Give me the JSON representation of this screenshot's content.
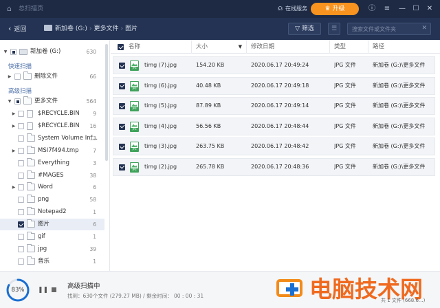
{
  "titlebar": {
    "app_title": "总扫描页",
    "service": "在线服务",
    "upgrade": "升级",
    "icons": [
      "home-icon",
      "headset-icon",
      "crown-icon",
      "info-icon",
      "menu-icon",
      "minimize-icon",
      "maximize-icon",
      "close-icon"
    ]
  },
  "nav": {
    "back": "返回",
    "crumbs": [
      "新加卷 (G:)",
      "更多文件",
      "图片"
    ],
    "filter": "筛选",
    "search_placeholder": "搜索文件或文件夹"
  },
  "sidebar": {
    "root": {
      "label": "新加卷 (G:)",
      "count": "630"
    },
    "quick_scan": "快速扫描",
    "deleted": {
      "label": "删除文件",
      "count": "66"
    },
    "advanced_scan": "高级扫描",
    "more_files": {
      "label": "更多文件",
      "count": "564"
    },
    "items": [
      {
        "label": "$RECYCLE.BIN",
        "count": "9",
        "expand": true,
        "type": "doc"
      },
      {
        "label": "$RECYCLE.BIN",
        "count": "16",
        "expand": true,
        "type": "doc"
      },
      {
        "label": "System Volume Inf...",
        "count": "13",
        "expand": false,
        "type": "folder"
      },
      {
        "label": "MSI7f494.tmp",
        "count": "7",
        "expand": true,
        "type": "folder"
      },
      {
        "label": "Everything",
        "count": "3",
        "expand": false,
        "type": "folder"
      },
      {
        "label": "#MAGES",
        "count": "38",
        "expand": false,
        "type": "folder"
      },
      {
        "label": "Word",
        "count": "6",
        "expand": true,
        "type": "folder"
      },
      {
        "label": "png",
        "count": "58",
        "expand": false,
        "type": "folder"
      },
      {
        "label": "Notepad2",
        "count": "1",
        "expand": false,
        "type": "folder"
      },
      {
        "label": "图片",
        "count": "6",
        "expand": false,
        "type": "folder",
        "selected": true
      },
      {
        "label": "gif",
        "count": "1",
        "expand": false,
        "type": "folder"
      },
      {
        "label": "jpg",
        "count": "39",
        "expand": false,
        "type": "folder"
      },
      {
        "label": "音乐",
        "count": "1",
        "expand": false,
        "type": "folder"
      }
    ]
  },
  "table": {
    "headers": [
      "名称",
      "大小",
      "修改日期",
      "类型",
      "路径"
    ],
    "rows": [
      {
        "name": "timg (7).jpg",
        "size": "154.20 KB",
        "date": "2020.06.17 20:49:24",
        "type": "JPG 文件",
        "path": "新加卷 (G:)\\更多文件"
      },
      {
        "name": "timg (6).jpg",
        "size": "40.48 KB",
        "date": "2020.06.17 20:49:18",
        "type": "JPG 文件",
        "path": "新加卷 (G:)\\更多文件"
      },
      {
        "name": "timg (5).jpg",
        "size": "87.89 KB",
        "date": "2020.06.17 20:49:14",
        "type": "JPG 文件",
        "path": "新加卷 (G:)\\更多文件"
      },
      {
        "name": "timg (4).jpg",
        "size": "56.56 KB",
        "date": "2020.06.17 20:48:44",
        "type": "JPG 文件",
        "path": "新加卷 (G:)\\更多文件"
      },
      {
        "name": "timg (3).jpg",
        "size": "263.75 KB",
        "date": "2020.06.17 20:48:42",
        "type": "JPG 文件",
        "path": "新加卷 (G:)\\更多文件"
      },
      {
        "name": "timg (2).jpg",
        "size": "265.78 KB",
        "date": "2020.06.17 20:48:36",
        "type": "JPG 文件",
        "path": "新加卷 (G:)\\更多文件"
      }
    ]
  },
  "status": {
    "progress_percent": 83,
    "progress_label": "83%",
    "title": "高级扫描中",
    "detail": "找到：630个文件 (279.27 MB) / 剩余时间：  00 : 00 : 31"
  },
  "watermark": {
    "text": "电脑技术网",
    "small": "共 1 文件 (668.6...)"
  },
  "colors": {
    "titlebar": "#1e2a44",
    "navbar": "#243353",
    "accent_orange": "#f7931e",
    "checkbox": "#243353",
    "progress": "#1a6fd1"
  }
}
